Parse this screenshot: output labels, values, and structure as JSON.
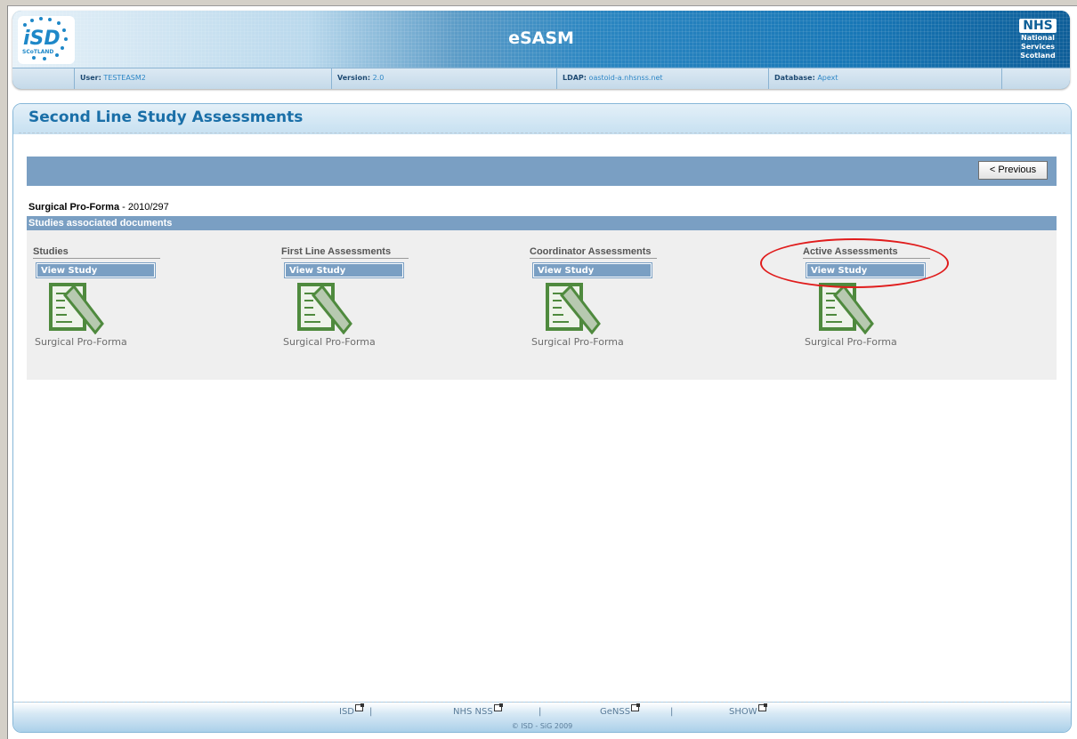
{
  "header": {
    "app_title": "eSASM",
    "logo_isd_text": "iSD",
    "logo_isd_sub": "SCoTLAND",
    "nhs_logo": {
      "box": "NHS",
      "line1": "National",
      "line2": "Services",
      "line3": "Scotland"
    },
    "info": {
      "user_label": "User:",
      "user_value": "TESTEASM2",
      "version_label": "Version:",
      "version_value": "2.0",
      "ldap_label": "LDAP:",
      "ldap_value": "oastoid-a.nhsnss.net",
      "database_label": "Database:",
      "database_value": "Apext"
    }
  },
  "page": {
    "title": "Second Line Study Assessments",
    "previous_button": "< Previous",
    "document_name": "Surgical Pro-Forma",
    "document_ref": " - 2010/297",
    "section_title": "Studies associated documents"
  },
  "columns": [
    {
      "title": "Studies",
      "button": "View Study",
      "caption": "Surgical Pro-Forma"
    },
    {
      "title": "First Line Assessments",
      "button": "View Study",
      "caption": "Surgical Pro-Forma"
    },
    {
      "title": "Coordinator Assessments",
      "button": "View Study",
      "caption": "Surgical Pro-Forma"
    },
    {
      "title": "Active Assessments",
      "button": "View Study",
      "caption": "Surgical Pro-Forma"
    }
  ],
  "footer": {
    "links": [
      "ISD",
      "NHS NSS",
      "GeNSS",
      "SHOW"
    ],
    "separator": "|",
    "copyright": "© ISD - SiG 2009"
  },
  "colors": {
    "accent": "#7a9fc3",
    "title": "#1a6fa8",
    "highlight": "#e01c1c",
    "icon_green": "#4f8a3e"
  }
}
